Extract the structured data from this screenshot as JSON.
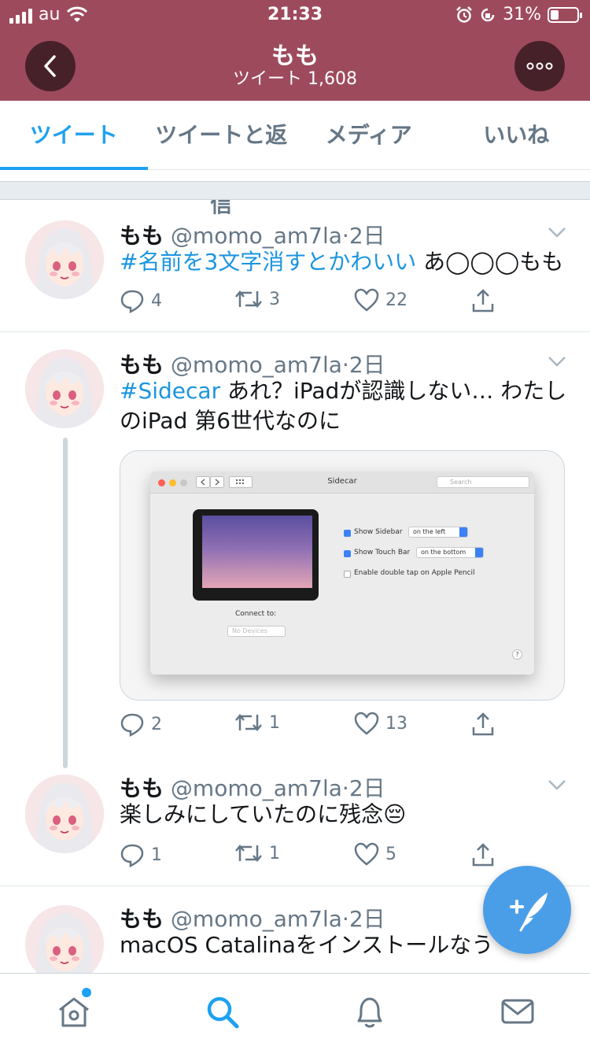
{
  "status_bar": {
    "carrier": "au",
    "time": "21:33",
    "battery": "31%",
    "battery_level": 0.31
  },
  "header": {
    "title": "もも",
    "subtitle": "ツイート 1,608"
  },
  "tabs": [
    {
      "label": "ツイート",
      "active": true
    },
    {
      "label": "ツイートと返信",
      "active": false
    },
    {
      "label": "メディア",
      "active": false
    },
    {
      "label": "いいね",
      "active": false
    }
  ],
  "colors": {
    "header_bg": "#9e4a5d",
    "accent": "#1da1f2",
    "hashtag": "#1b95e0",
    "fab": "#4a9ee8"
  },
  "tweets": [
    {
      "name": "もも",
      "handle": "@momo_am7la",
      "dot": "·",
      "time": "2日",
      "hashtag": "#名前を3文字消すとかわいい",
      "text": " あ◯◯◯もも",
      "replies": "4",
      "retweets": "3",
      "likes": "22"
    },
    {
      "name": "もも",
      "handle": "@momo_am7la",
      "dot": "·",
      "time": "2日",
      "hashtag": "#Sidecar",
      "text": " あれ？iPadが認識しない… わたしのiPad 第6世代なのに",
      "replies": "2",
      "retweets": "1",
      "likes": "13",
      "media": {
        "window_title": "Sidecar",
        "search_placeholder": "Search",
        "show_sidebar": "Show Sidebar",
        "sidebar_option": "on the left",
        "show_touch_bar": "Show Touch Bar",
        "touch_bar_option": "on the bottom",
        "double_tap": "Enable double tap on Apple Pencil",
        "connect_to": "Connect to:",
        "devices": "No Devices",
        "help": "?"
      }
    },
    {
      "name": "もも",
      "handle": "@momo_am7la",
      "dot": "·",
      "time": "2日",
      "hashtag": "",
      "text": "楽しみにしていたのに残念😔",
      "replies": "1",
      "retweets": "1",
      "likes": "5"
    },
    {
      "name": "もも",
      "handle": "@momo_am7la",
      "dot": "·",
      "time": "2日",
      "hashtag": "",
      "text": "macOS Catalinaをインストールなう"
    }
  ],
  "bottom_nav": [
    "home-icon",
    "search-icon",
    "notifications-icon",
    "messages-icon"
  ]
}
